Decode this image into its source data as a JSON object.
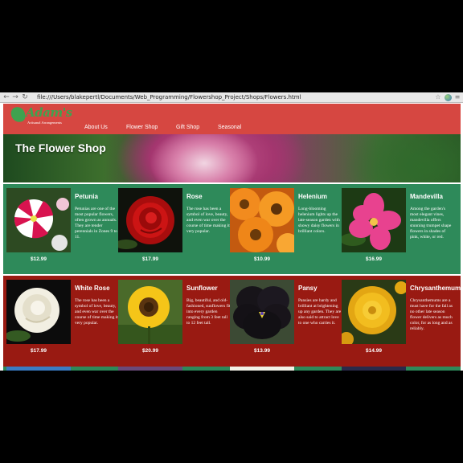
{
  "browser": {
    "url": "file:///Users/blakepertl/Documents/Web_Programming/Flowershop_Project/Shops/Flowers.html",
    "back_icon": "←",
    "forward_icon": "→",
    "reload_icon": "↻",
    "star_icon": "☆",
    "menu_icon": "≡"
  },
  "site": {
    "logo_name": "Adam's",
    "logo_tagline": "Artisanal Arrangements",
    "nav": [
      "About Us",
      "Flower Shop",
      "Gift Shop",
      "Seasonal"
    ]
  },
  "hero": {
    "title": "The Flower Shop"
  },
  "rows": [
    {
      "color": "#2e8a5a",
      "flowers": [
        {
          "name": "Petunia",
          "desc": "Petunias are one of the most popular flowers, often grown as annuals. They are tender perennials in Zones 9 to 11.",
          "price": "$12.99"
        },
        {
          "name": "Rose",
          "desc": "The rose has been a symbol of love, beauty, and even war over the course of time making it very popular.",
          "price": "$17.99"
        },
        {
          "name": "Helenium",
          "desc": "Long-blooming helenium lights up the late-season garden with showy daisy flowers in brilliant colors.",
          "price": "$10.99"
        },
        {
          "name": "Mandevilla",
          "desc": "Among the garden's most elegant vines, mandevilla offers stunning trumpet shape flowers in shades of pink, white, or red.",
          "price": "$16.99"
        }
      ]
    },
    {
      "color": "#991a12",
      "flowers": [
        {
          "name": "White Rose",
          "desc": "The rose has been a symbol of love, beauty, and even war over the course of time making it very popular.",
          "price": "$17.99"
        },
        {
          "name": "Sunflower",
          "desc": "Big, beautiful, and old-fashioned, sunflowers fit into every garden ranging from 3 feet tall to 12 feet tall.",
          "price": "$20.99"
        },
        {
          "name": "Pansy",
          "desc": "Pansies are hardy and brilliant at brightening up any garden. They are also said to attract love to one who carries it.",
          "price": "$13.99"
        },
        {
          "name": "Chrysanthemum",
          "desc": "Chrysanthemums are a must have for the fall as no other late season flower delivers as much color, for as long and as reliably.",
          "price": "$14.99"
        }
      ]
    }
  ]
}
